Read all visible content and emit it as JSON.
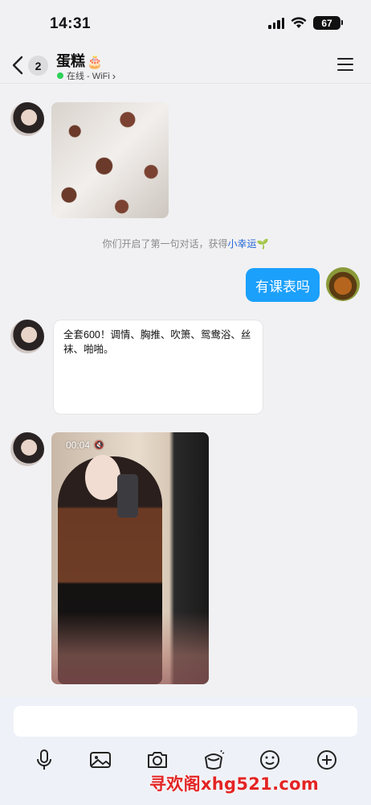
{
  "status_bar": {
    "time": "14:31",
    "battery": "67"
  },
  "header": {
    "unread_count": "2",
    "contact_name": "蛋糕",
    "name_emoji": "🎂",
    "status_text": "在线 - WiFi",
    "status_chevron": "›",
    "online_color": "#2ed15a"
  },
  "messages": {
    "system_note_prefix": "你们开启了第一句对话，获得",
    "system_note_link": "小幸运",
    "system_note_emoji": "🌱",
    "outgoing_text": "有课表吗",
    "card_text": "全套600！调情、胸推、吹箫、鸳鸯浴、丝袜、啪啪。",
    "video_duration": "00:04",
    "video_mute_icon": "🔇"
  },
  "colors": {
    "outgoing_bubble": "#1ba0fb",
    "link": "#1e63d6"
  },
  "toolbar": {
    "icons": [
      "microphone-icon",
      "image-icon",
      "camera-icon",
      "red-packet-icon",
      "emoji-icon",
      "plus-icon"
    ]
  },
  "watermark": "寻欢阁xhg521.com"
}
